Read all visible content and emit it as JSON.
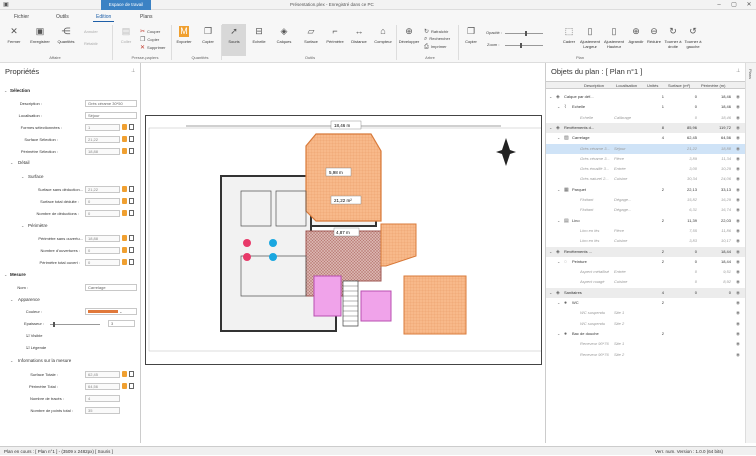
{
  "titlebar": {
    "workspace": "Espace de travail",
    "title": "Présentation.plex - Enregistré dans ce PC"
  },
  "tabs": [
    "Fichier",
    "Outils",
    "Edition",
    "Plans"
  ],
  "ribbon": {
    "buttons": [
      {
        "id": "fermer",
        "label": "Fermer"
      },
      {
        "id": "enregistrer",
        "label": "Enregistrer"
      },
      {
        "id": "quantites",
        "label": "Quantités"
      },
      {
        "id": "coller",
        "label": "Coller"
      },
      {
        "id": "exporter",
        "label": "Exporter"
      },
      {
        "id": "copier",
        "label": "Copier"
      },
      {
        "id": "souris",
        "label": "Souris"
      },
      {
        "id": "echelle",
        "label": "Echelle"
      },
      {
        "id": "calques",
        "label": "Calques"
      },
      {
        "id": "surface",
        "label": "Surface"
      },
      {
        "id": "perimetre",
        "label": "Périmètre"
      },
      {
        "id": "distance",
        "label": "Distance"
      },
      {
        "id": "compteur",
        "label": "Compteur"
      },
      {
        "id": "developper",
        "label": "Développer"
      },
      {
        "id": "copier2",
        "label": "Copier"
      },
      {
        "id": "cadrer",
        "label": "Cadrer"
      },
      {
        "id": "ajust-largeur",
        "label": "Ajustement Largeur"
      },
      {
        "id": "ajust-hauteur",
        "label": "Ajustement Hauteur"
      },
      {
        "id": "agrandir",
        "label": "Agrandir"
      },
      {
        "id": "reduire",
        "label": "Réduire"
      },
      {
        "id": "tourner-droite",
        "label": "Tourner à droite"
      },
      {
        "id": "tourner-gauche",
        "label": "Tourner à gauche"
      }
    ],
    "small": {
      "annuler": "Annuler",
      "retablir": "Rétablir",
      "couper": "Couper",
      "copier": "Copier",
      "supprimer": "Supprimer",
      "rafraichir": "Rafraîchir",
      "rechercher": "Rechercher",
      "imprimer": "Imprimer",
      "opacite": "Opacité :",
      "zoom": "Zoom :"
    },
    "groups": {
      "affaire": "Affaire",
      "presse": "Presse-papiers",
      "quantites": "Quantités",
      "outils": "Outils",
      "arbre": "Arbre",
      "plan": "Plan"
    }
  },
  "properties": {
    "title": "Propriétés",
    "selection": "Sélection",
    "description_label": "Description :",
    "description": "Grès cérame 30*50",
    "localisation_label": "Localisation :",
    "localisation": "Séjour",
    "formes_label": "Formes sélectionnées :",
    "formes": "1",
    "surface_sel_label": "Surface Sélection :",
    "surface_sel": "21,22",
    "perim_sel_label": "Périmètre Sélection :",
    "perim_sel": "18,88",
    "detail": "Détail",
    "surface": "Surface",
    "surf_sans_label": "Surface sans déduction...",
    "surf_sans": "21,22",
    "surf_deduite_label": "Surface total déduite :",
    "surf_deduite": "0",
    "nb_deductions_label": "Nombre de déductions :",
    "nb_deductions": "0",
    "perimetre": "Périmètre",
    "perim_sans_label": "Périmètre sans ouvertu...",
    "perim_sans": "18,88",
    "nb_ouvertures_label": "Nombre d'ouvertures :",
    "nb_ouvertures": "0",
    "perim_ouvert_label": "Périmètre total ouvert :",
    "perim_ouvert": "0",
    "mesure": "Mesure",
    "nom_label": "Nom :",
    "nom": "Carrelage",
    "apparence": "Apparence",
    "couleur_label": "Couleur :",
    "epaisseur_label": "Epaisseur :",
    "epaisseur": "3",
    "visible": "Visible",
    "legende": "Légende",
    "info_mesure": "Informations sur la mesure",
    "surf_totale_label": "Surface Totale :",
    "surf_totale": "62,45",
    "perim_total_label": "Périmètre Total :",
    "perim_total": "64,56",
    "nb_traces_label": "Nombre de tracés :",
    "nb_traces": "4",
    "nb_points_label": "Nombre de points total :",
    "nb_points": "35"
  },
  "objects": {
    "title": "Objets du plan : [ Plan n°1 ]",
    "columns": [
      "Description",
      "Localisation",
      "Unités",
      "Surface (m²)",
      "Périmètre (m)"
    ],
    "rows": [
      {
        "lvl": 0,
        "ex": "⌄",
        "ico": "◈",
        "name": "Calque par déf...",
        "loc": "",
        "u": "1",
        "s": "0",
        "p": "18,46",
        "cls": "g1"
      },
      {
        "lvl": 1,
        "ex": "⌄",
        "ico": "⌇",
        "name": "Echelle",
        "loc": "",
        "u": "1",
        "s": "0",
        "p": "18,46",
        "cls": "g1"
      },
      {
        "lvl": 2,
        "ex": "",
        "ico": "",
        "name": "Echelle",
        "loc": "Calibrage",
        "u": "",
        "s": "0",
        "p": "18,46",
        "cls": "g1 dim"
      },
      {
        "lvl": 0,
        "ex": "⌄",
        "ico": "◈",
        "name": "Revêtements d...",
        "loc": "",
        "u": "8",
        "s": "85,96",
        "p": "119,72",
        "cls": "g2"
      },
      {
        "lvl": 1,
        "ex": "⌄",
        "ico": "▧",
        "name": "Carrelage",
        "loc": "",
        "u": "4",
        "s": "62,45",
        "p": "64,56",
        "cls": "g1"
      },
      {
        "lvl": 2,
        "ex": "",
        "ico": "",
        "name": "Grès cérame 3...",
        "loc": "Séjour",
        "u": "",
        "s": "21,22",
        "p": "18,88",
        "cls": "sel dim"
      },
      {
        "lvl": 2,
        "ex": "",
        "ico": "",
        "name": "Grès cérame 3...",
        "loc": "Pièce",
        "u": "",
        "s": "3,89",
        "p": "11,34",
        "cls": "g1 dim"
      },
      {
        "lvl": 2,
        "ex": "",
        "ico": "",
        "name": "Grès émaillé 3...",
        "loc": "Entrée",
        "u": "",
        "s": "3,00",
        "p": "10,29",
        "cls": "g1 dim"
      },
      {
        "lvl": 2,
        "ex": "",
        "ico": "",
        "name": "Grès naturel 2...",
        "loc": "Cuisine",
        "u": "",
        "s": "30,34",
        "p": "24,06",
        "cls": "g1 dim"
      },
      {
        "lvl": 1,
        "ex": "⌄",
        "ico": "▦",
        "name": "Parquet",
        "loc": "",
        "u": "2",
        "s": "22,13",
        "p": "33,13",
        "cls": "g1"
      },
      {
        "lvl": 2,
        "ex": "",
        "ico": "",
        "name": "Flottant",
        "loc": "Dégage...",
        "u": "",
        "s": "15,82",
        "p": "16,29",
        "cls": "g1 dim"
      },
      {
        "lvl": 2,
        "ex": "",
        "ico": "",
        "name": "Flottant",
        "loc": "Dégage...",
        "u": "",
        "s": "6,31",
        "p": "16,74",
        "cls": "g1 dim"
      },
      {
        "lvl": 1,
        "ex": "⌄",
        "ico": "▤",
        "name": "Lino",
        "loc": "",
        "u": "2",
        "s": "11,39",
        "p": "22,03",
        "cls": "g1"
      },
      {
        "lvl": 2,
        "ex": "",
        "ico": "",
        "name": "Lino en lés",
        "loc": "Pièce",
        "u": "",
        "s": "7,55",
        "p": "11,86",
        "cls": "g1 dim"
      },
      {
        "lvl": 2,
        "ex": "",
        "ico": "",
        "name": "Lino en lés",
        "loc": "Cuisine",
        "u": "",
        "s": "3,83",
        "p": "10,17",
        "cls": "g1 dim"
      },
      {
        "lvl": 0,
        "ex": "⌄",
        "ico": "◈",
        "name": "Revêtements ...",
        "loc": "",
        "u": "2",
        "s": "0",
        "p": "18,44",
        "cls": "g2"
      },
      {
        "lvl": 1,
        "ex": "⌄",
        "ico": "◌",
        "name": "Peinture",
        "loc": "",
        "u": "2",
        "s": "0",
        "p": "18,44",
        "cls": "g1"
      },
      {
        "lvl": 2,
        "ex": "",
        "ico": "",
        "name": "Aspect métallisé",
        "loc": "Entrée",
        "u": "",
        "s": "0",
        "p": "9,51",
        "cls": "g1 dim"
      },
      {
        "lvl": 2,
        "ex": "",
        "ico": "",
        "name": "Aspect nuagé",
        "loc": "Cuisine",
        "u": "",
        "s": "0",
        "p": "8,92",
        "cls": "g1 dim"
      },
      {
        "lvl": 0,
        "ex": "⌄",
        "ico": "◈",
        "name": "Sanitaires",
        "loc": "",
        "u": "4",
        "s": "0",
        "p": "0",
        "cls": "g2"
      },
      {
        "lvl": 1,
        "ex": "⌄",
        "ico": "●",
        "name": "WC",
        "loc": "",
        "u": "2",
        "s": "",
        "p": "",
        "cls": "g1"
      },
      {
        "lvl": 2,
        "ex": "",
        "ico": "",
        "name": "WC suspendu",
        "loc": "Site 1",
        "u": "",
        "s": "",
        "p": "",
        "cls": "g1 dim"
      },
      {
        "lvl": 2,
        "ex": "",
        "ico": "",
        "name": "WC suspendu",
        "loc": "Site 2",
        "u": "",
        "s": "",
        "p": "",
        "cls": "g1 dim"
      },
      {
        "lvl": 1,
        "ex": "⌄",
        "ico": "●",
        "name": "Bac de douche",
        "loc": "",
        "u": "2",
        "s": "",
        "p": "",
        "cls": "g1"
      },
      {
        "lvl": 2,
        "ex": "",
        "ico": "",
        "name": "Receveur 90*76",
        "loc": "Site 1",
        "u": "",
        "s": "",
        "p": "",
        "cls": "g1 dim"
      },
      {
        "lvl": 2,
        "ex": "",
        "ico": "",
        "name": "Receveur 90*76",
        "loc": "Site 2",
        "u": "",
        "s": "",
        "p": "",
        "cls": "g1 dim"
      }
    ]
  },
  "plan": {
    "dim_top": "18,46 m",
    "dim_right": "5,98 m",
    "dim_mid": "21,22 m²",
    "dim_left": "4,87 m"
  },
  "sidestrip": "Plans",
  "status": {
    "left": "Plan en cours : [ Plan n°1 ] - (3509 x 2482px)   [ Souris ]",
    "right": "Verr. num.   Version : 1.0.0 (64 bits)"
  },
  "colors": {
    "accent": "#1e5fa8",
    "orange": "#f5a060",
    "red": "#c4706b",
    "pink": "#e87fd8",
    "color_swatch": "#e0783a"
  }
}
